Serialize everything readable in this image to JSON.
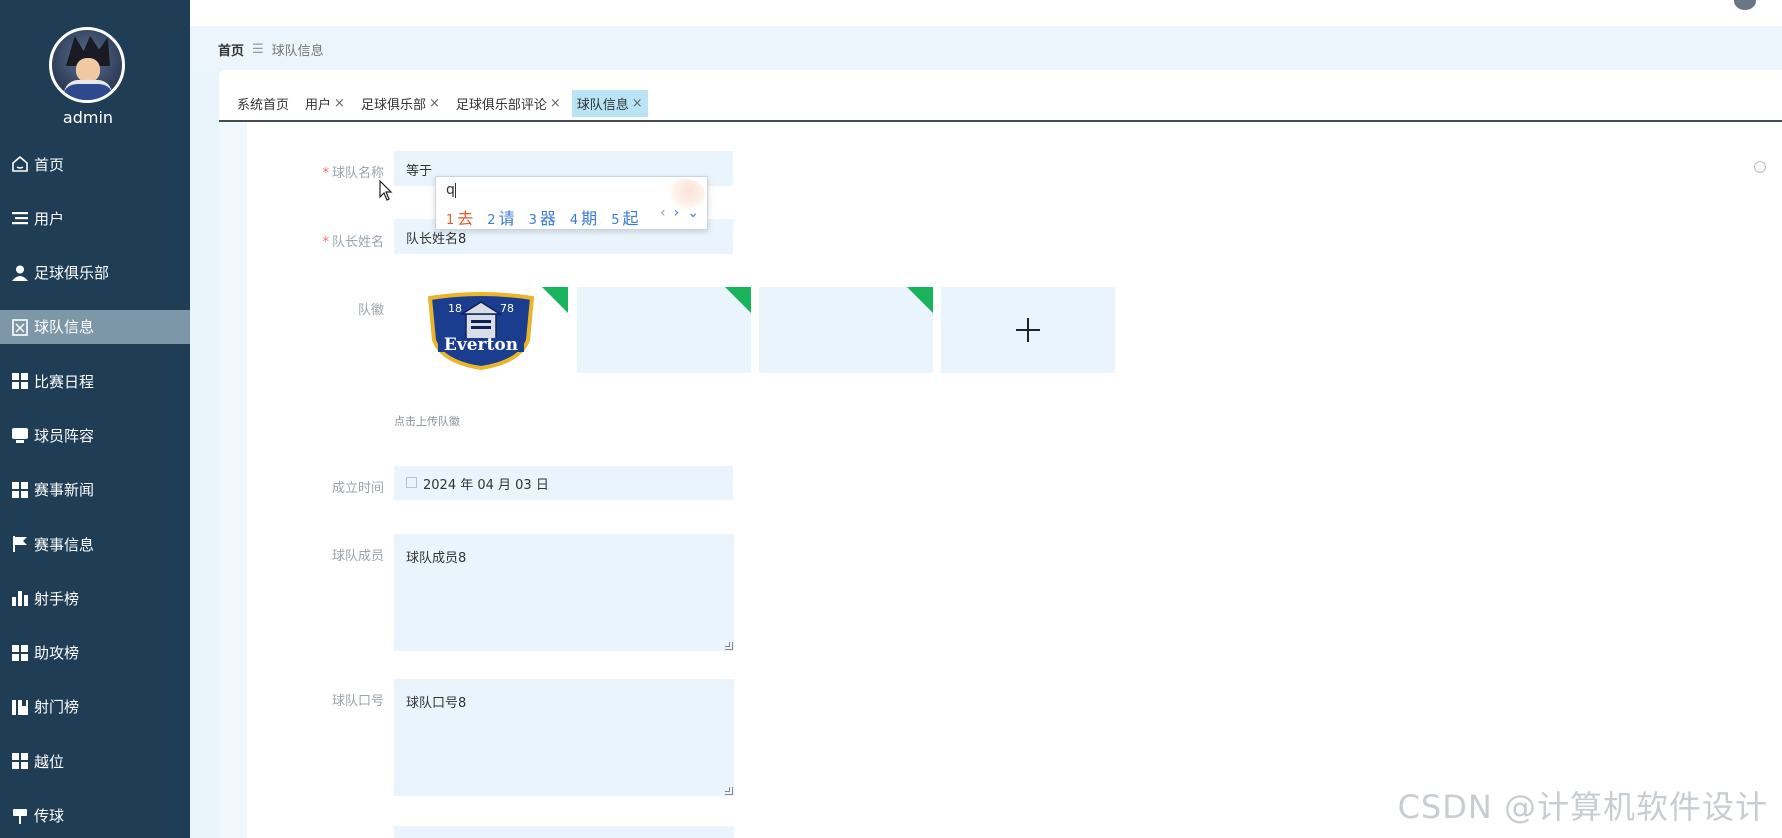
{
  "user": {
    "name": "admin"
  },
  "sidebar": {
    "items": [
      {
        "label": "首页",
        "icon": "home-icon"
      },
      {
        "label": "用户",
        "icon": "list-icon"
      },
      {
        "label": "足球俱乐部",
        "icon": "person-icon"
      },
      {
        "label": "球队信息",
        "icon": "clipboard-icon",
        "active": true
      },
      {
        "label": "比赛日程",
        "icon": "grid-icon"
      },
      {
        "label": "球员阵容",
        "icon": "monitor-icon"
      },
      {
        "label": "赛事新闻",
        "icon": "grid-icon"
      },
      {
        "label": "赛事信息",
        "icon": "flag-icon"
      },
      {
        "label": "射手榜",
        "icon": "bar-chart-icon"
      },
      {
        "label": "助攻榜",
        "icon": "grid-icon"
      },
      {
        "label": "射门榜",
        "icon": "book-icon"
      },
      {
        "label": "越位",
        "icon": "grid-icon"
      },
      {
        "label": "传球",
        "icon": "pin-icon"
      }
    ]
  },
  "breadcrumb": {
    "home": "首页",
    "separator": "☰",
    "current": "球队信息"
  },
  "tabs": [
    {
      "label": "系统首页",
      "closable": false
    },
    {
      "label": "用户",
      "closable": true
    },
    {
      "label": "足球俱乐部",
      "closable": true
    },
    {
      "label": "足球俱乐部评论",
      "closable": true
    },
    {
      "label": "球队信息",
      "closable": true,
      "active": true
    }
  ],
  "tab_close_glyph": "×",
  "form": {
    "team_name": {
      "label": "球队名称",
      "value": "等于"
    },
    "captain": {
      "label": "队长姓名",
      "value": "队长姓名8"
    },
    "logo": {
      "label": "队徽",
      "hint": "点击上传队徽",
      "add_glyph": "+"
    },
    "founded": {
      "label": "成立时间",
      "value": "2024 年 04 月 03 日"
    },
    "members": {
      "label": "球队成员",
      "value": "球队成员8"
    },
    "slogan": {
      "label": "球队口号",
      "value": "球队口号8"
    }
  },
  "ime": {
    "input": "q",
    "candidates": [
      {
        "n": "1",
        "text": "去"
      },
      {
        "n": "2",
        "text": "请"
      },
      {
        "n": "3",
        "text": "器"
      },
      {
        "n": "4",
        "text": "期"
      },
      {
        "n": "5",
        "text": "起"
      }
    ],
    "prev": "‹",
    "next": "›",
    "more": "⌄"
  },
  "logo_image": {
    "text_top": "18",
    "text_top_right": "78",
    "text_main": "Everton"
  },
  "watermark": "CSDN @计算机软件设计",
  "colors": {
    "sidebar": "#1f3d55",
    "active_nav": "#7d97a9",
    "active_tab": "#b8e4f6",
    "accent_green": "#19b35b"
  }
}
